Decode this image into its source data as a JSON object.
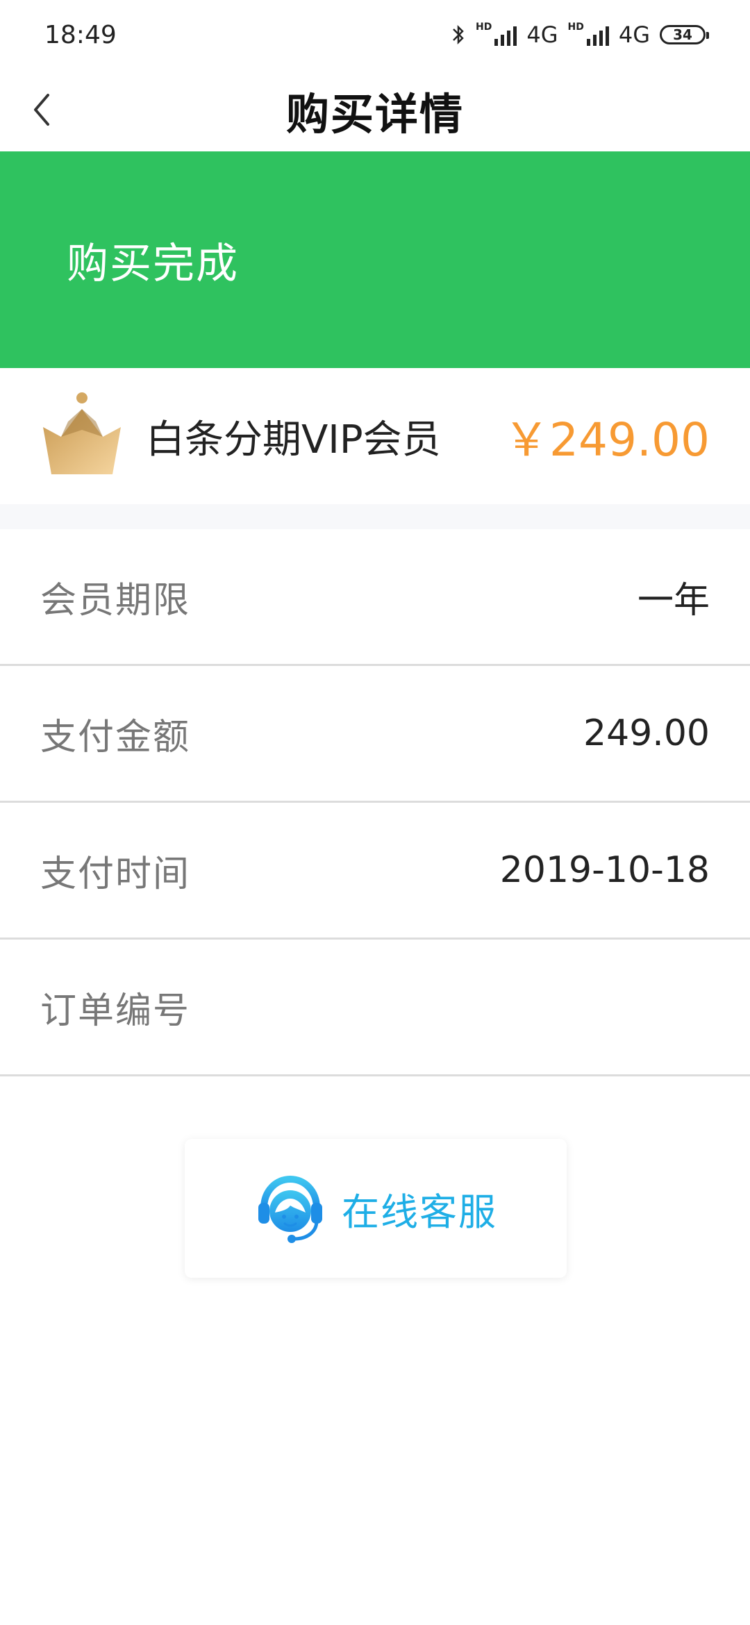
{
  "status_bar": {
    "time": "18:49",
    "network_1": "4G",
    "network_2": "4G",
    "battery": "34"
  },
  "nav": {
    "title": "购买详情"
  },
  "banner": {
    "status": "购买完成",
    "color": "#2fc25f"
  },
  "product": {
    "name": "白条分期VIP会员",
    "price": "￥249.00",
    "price_color": "#f79a33",
    "icon": "crown-icon"
  },
  "details": [
    {
      "label": "会员期限",
      "value": "一年"
    },
    {
      "label": "支付金额",
      "value": "249.00"
    },
    {
      "label": "支付时间",
      "value": "2019-10-18"
    },
    {
      "label": "订单编号",
      "value": ""
    }
  ],
  "service": {
    "label": "在线客服",
    "icon": "customer-service-icon",
    "color": "#1eaee6"
  }
}
